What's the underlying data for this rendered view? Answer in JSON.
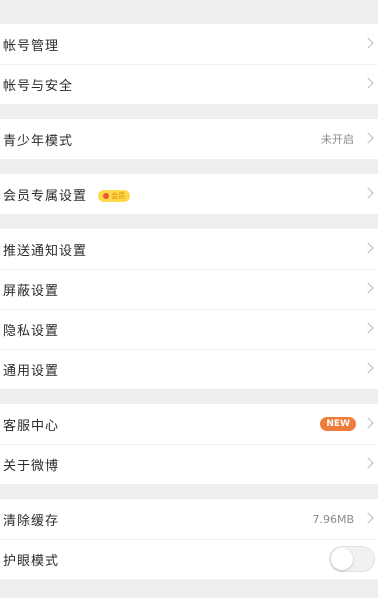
{
  "groups": {
    "account": {
      "management": "帐号管理",
      "security": "帐号与安全"
    },
    "youth": {
      "label": "青少年模式",
      "status": "未开启"
    },
    "member": {
      "label": "会员专属设置",
      "badge": "会员"
    },
    "settings": {
      "push": "推送通知设置",
      "block": "屏蔽设置",
      "privacy": "隐私设置",
      "general": "通用设置"
    },
    "support": {
      "service": "客服中心",
      "service_badge": "NEW",
      "about": "关于微博"
    },
    "storage": {
      "clear_cache": "清除缓存",
      "cache_size": "7.96MB",
      "eye_mode": "护眼模式",
      "eye_mode_on": false
    }
  },
  "colors": {
    "background": "#eeeeee",
    "new_badge": "#ee7c3a",
    "vip_badge": "#ffd84a"
  }
}
